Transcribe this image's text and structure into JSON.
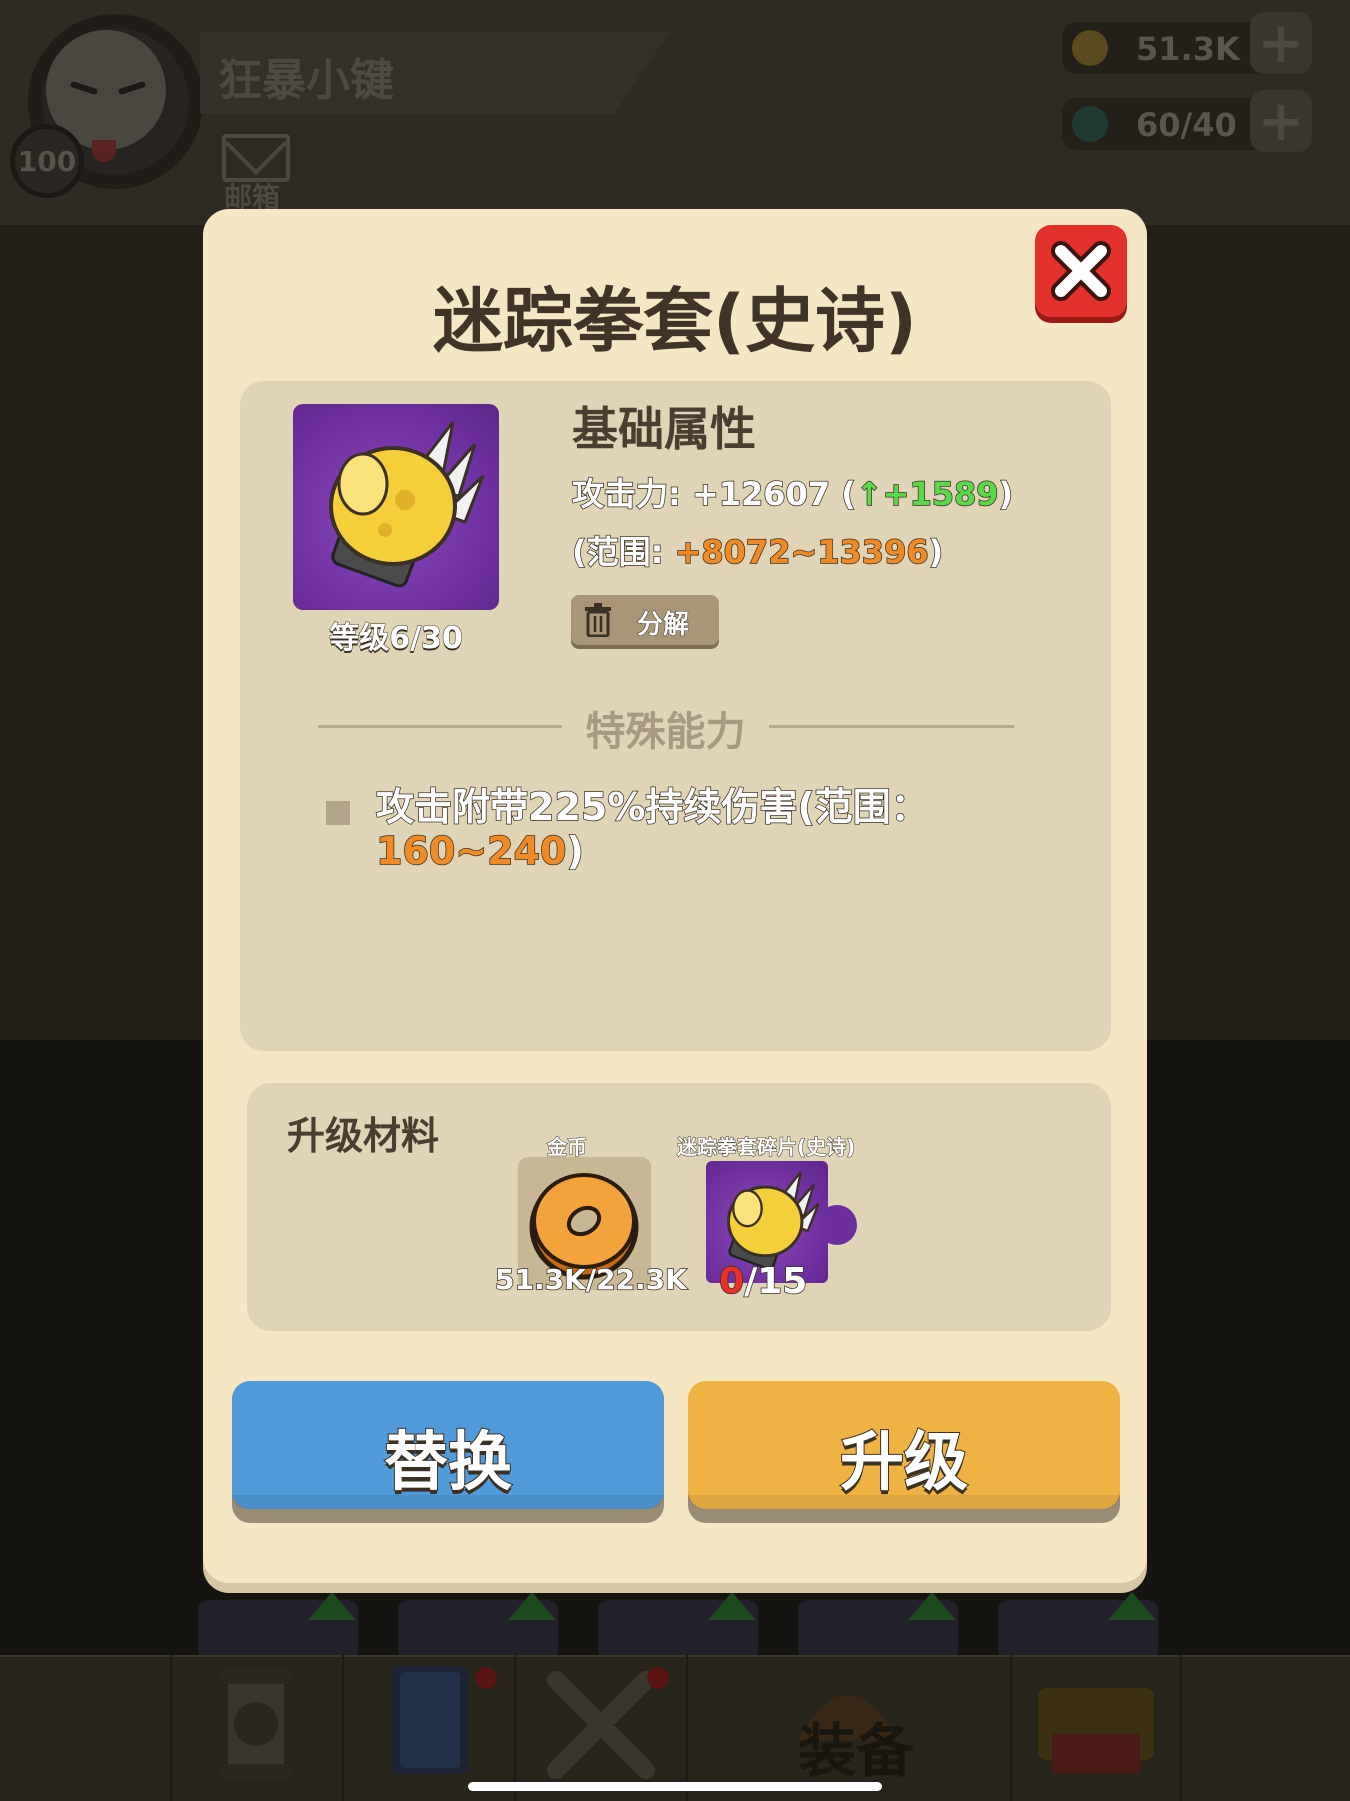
{
  "background": {
    "player": {
      "name": "狂暴小键",
      "level": "100"
    },
    "mailbox_label": "邮箱",
    "resources": {
      "gold": "51.3K",
      "energy": "60/40"
    },
    "tab_bar": {
      "equipment_label": "装备"
    }
  },
  "modal": {
    "title": "迷踪拳套(史诗)",
    "item": {
      "level_text": "等级6/30",
      "icon": "golden-fist-gauntlet-icon"
    },
    "base_attributes": {
      "title": "基础属性",
      "attack_prefix": "攻击力: +12607 (",
      "attack_arrow": "↑",
      "attack_bonus": "+1589",
      "attack_suffix": ")",
      "range_prefix": "(范围: ",
      "range_value": "+8072~13396",
      "range_suffix": ")"
    },
    "dismantle_label": "分解",
    "special": {
      "title": "特殊能力",
      "ability_text": "攻击附带225%持续伤害(范围：",
      "ability_range": "160~240",
      "ability_suffix": ")"
    },
    "materials": {
      "title": "升级材料",
      "coin": {
        "caption": "金币",
        "count": "51.3K/22.3K"
      },
      "fragment": {
        "caption": "迷踪拳套碎片(史诗)",
        "owned": "0",
        "required": "/15"
      }
    },
    "buttons": {
      "replace": "替换",
      "upgrade": "升级"
    },
    "colors": {
      "bonus_green": "#59d84a",
      "highlight_orange": "#f08a24",
      "shortage_red": "#e8302a",
      "replace_blue": "#519bdb",
      "upgrade_gold": "#efb343",
      "close_red": "#e2302b"
    }
  }
}
